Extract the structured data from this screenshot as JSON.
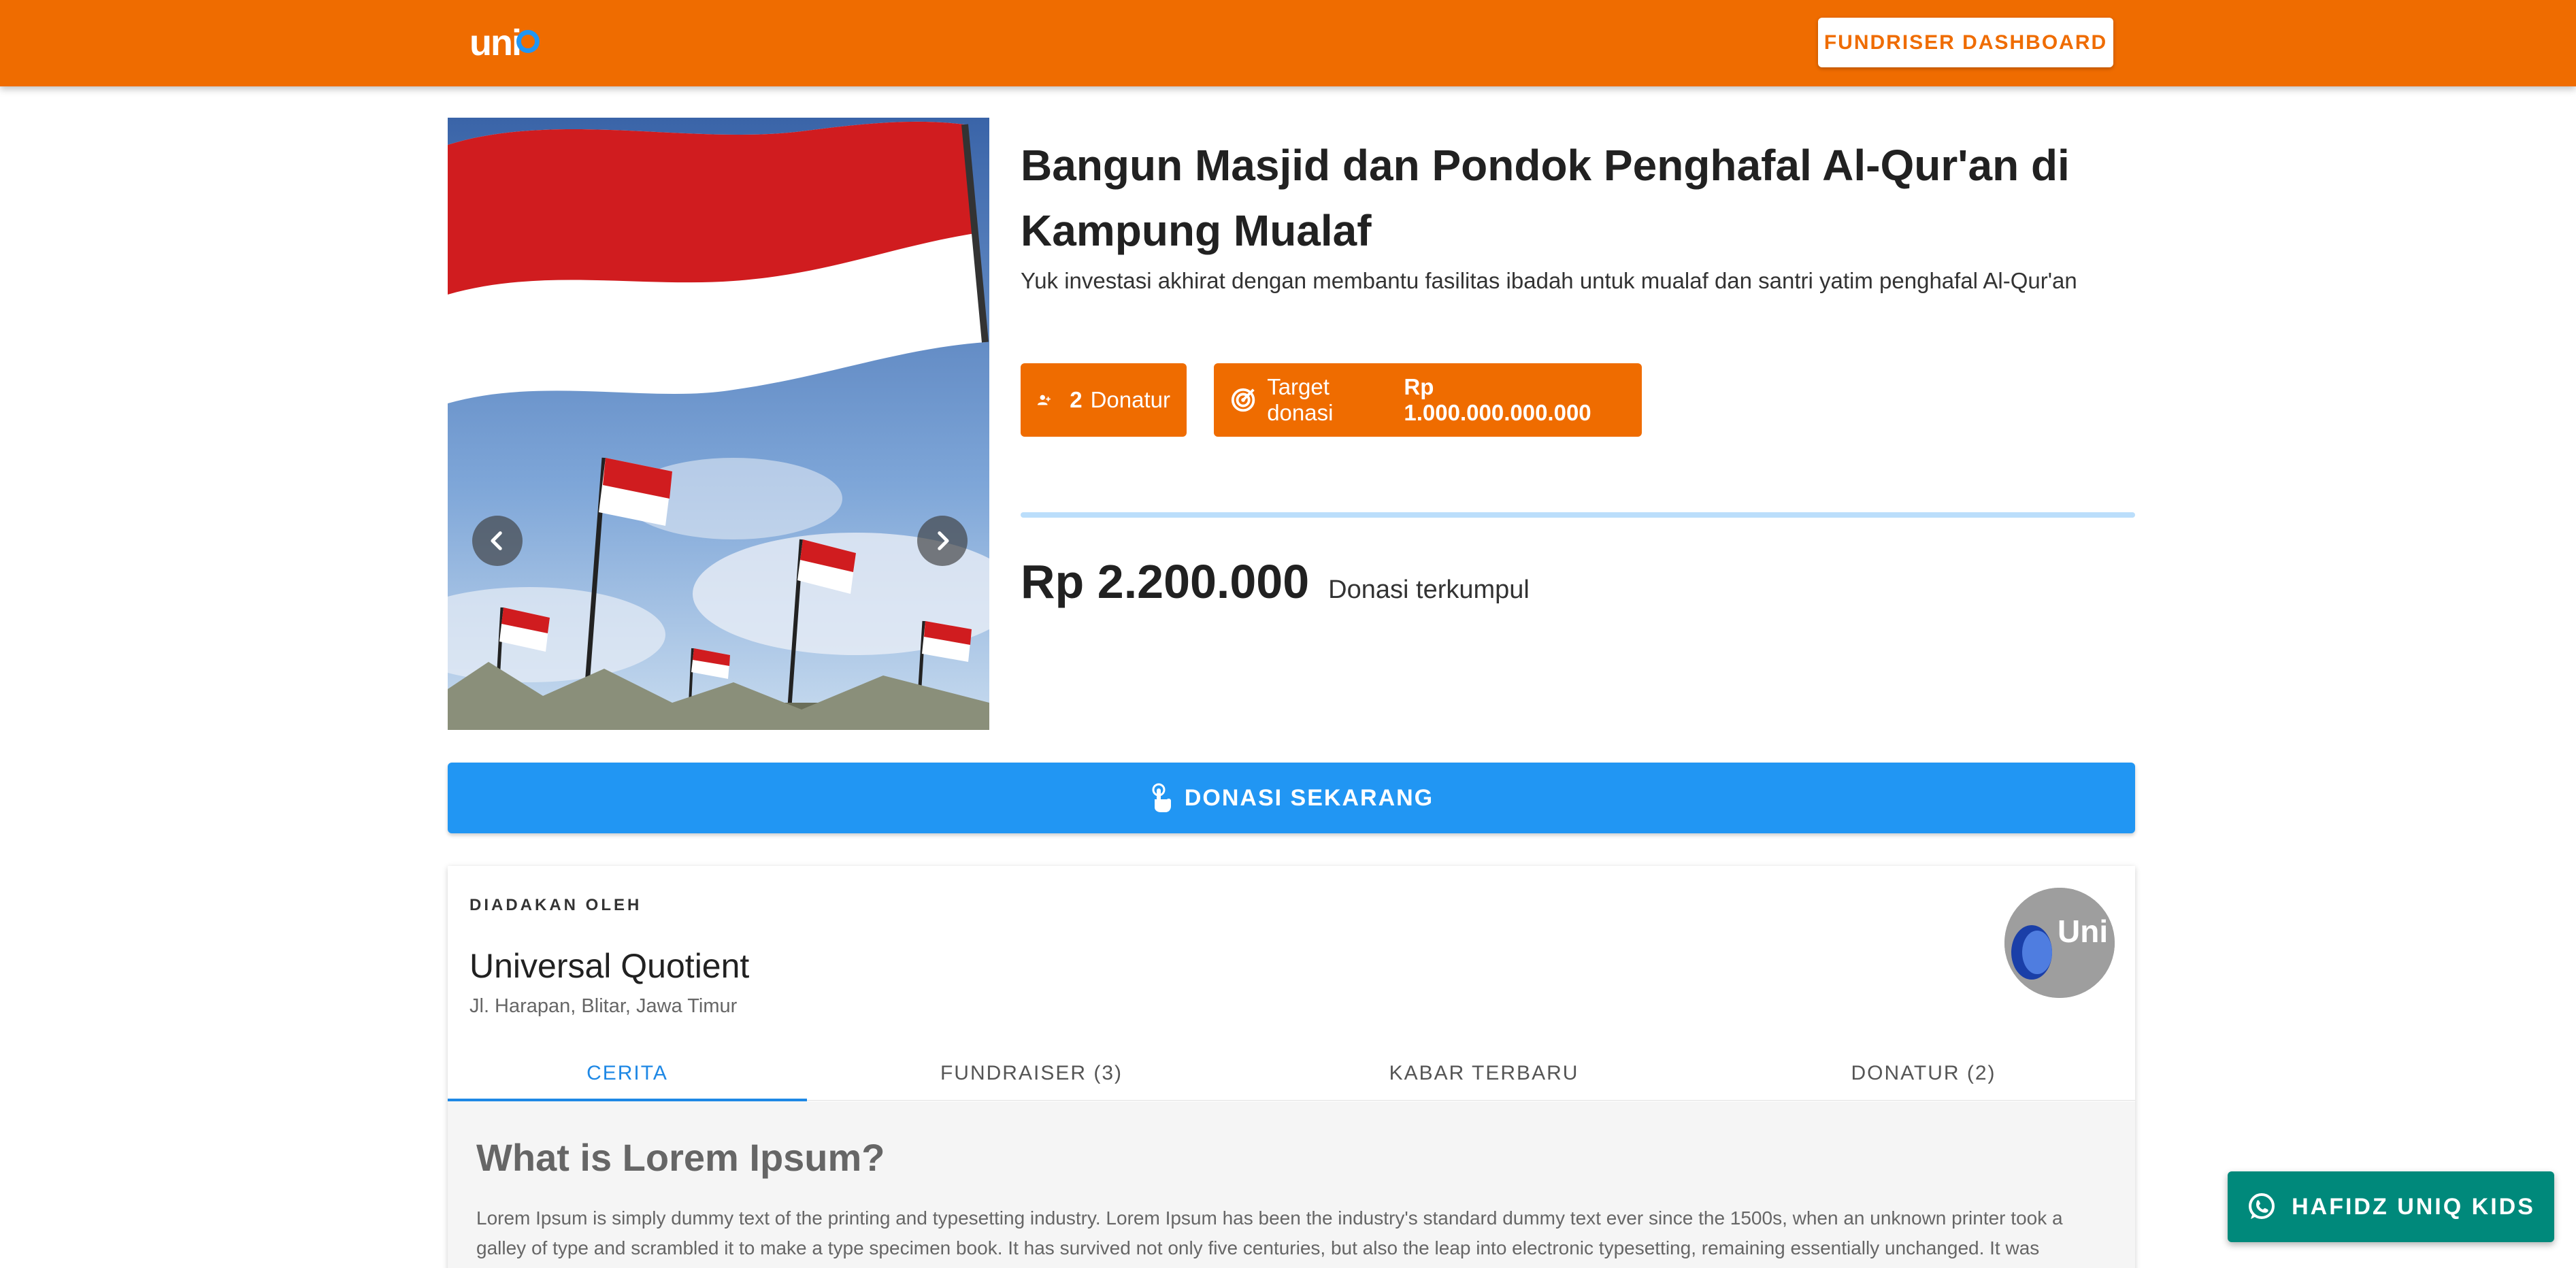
{
  "header": {
    "logo_text": "uni",
    "dashboard_button": "FUNDRISER DASHBOARD",
    "bar_color": "#ef6c00"
  },
  "carousel": {
    "image_alt": "Indonesian red and white flags",
    "prev_icon": "chevron-left-icon",
    "next_icon": "chevron-right-icon"
  },
  "campaign": {
    "title": "Bangun Masjid dan Pondok Penghafal Al-Qur'an di Kampung Mualaf",
    "subtitle": "Yuk investasi akhirat dengan membantu fasilitas ibadah untuk mualaf dan santri yatim penghafal Al-Qur'an",
    "donor_count": "2",
    "donor_label": "Donatur",
    "target_label": "Target donasi",
    "target_amount": "Rp 1.000.000.000.000",
    "progress_percent": 0.0002,
    "collected_amount": "Rp 2.200.000",
    "collected_label": "Donasi terkumpul"
  },
  "donate_button": "DONASI SEKARANG",
  "organizer": {
    "overline": "DIADAKAN OLEH",
    "name": "Universal Quotient",
    "address": "Jl. Harapan, Blitar, Jawa Timur",
    "avatar_text": "Uni"
  },
  "tabs": [
    {
      "label": "CERITA"
    },
    {
      "label": "FUNDRAISER (3)"
    },
    {
      "label": "KABAR TERBARU"
    },
    {
      "label": "DONATUR (2)"
    }
  ],
  "story": {
    "title": "What is Lorem Ipsum?",
    "text": "Lorem Ipsum is simply dummy text of the printing and typesetting industry. Lorem Ipsum has been the industry's standard dummy text ever since the 1500s, when an unknown printer took a galley of type and scrambled it to make a type specimen book. It has survived not only five centuries, but also the leap into electronic typesetting, remaining essentially unchanged. It was"
  },
  "whatsapp_button": "HAFIDZ UNIQ KIDS",
  "colors": {
    "primary_orange": "#ef6c00",
    "primary_blue": "#2196f3",
    "whatsapp_teal": "#00897b"
  }
}
